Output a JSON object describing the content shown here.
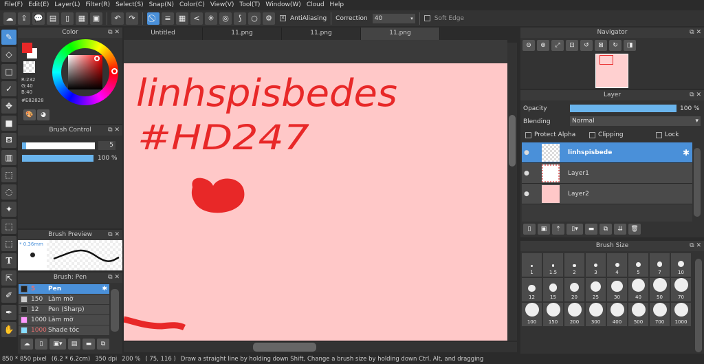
{
  "menu": [
    "File(F)",
    "Edit(E)",
    "Layer(L)",
    "Filter(R)",
    "Select(S)",
    "Snap(N)",
    "Color(C)",
    "View(V)",
    "Tool(T)",
    "Window(W)",
    "Cloud",
    "Help"
  ],
  "toolbar": {
    "antialiasing": "AntiAliasing",
    "correction_label": "Correction",
    "correction_value": "40",
    "soft_edge": "Soft Edge"
  },
  "tabs": [
    "Untitled",
    "11.png",
    "11.png",
    "11.png"
  ],
  "active_tab": 3,
  "color_panel": {
    "title": "Color",
    "r": "R:232",
    "g": "G:40",
    "b": "B:40",
    "hex": "#E82828",
    "primary": "#e82828"
  },
  "brush_control": {
    "title": "Brush Control",
    "size": "5",
    "opacity": "100 %",
    "opacity_value": 100
  },
  "brush_preview": {
    "title": "Brush Preview",
    "size": "* 0.36mm"
  },
  "brush_list": {
    "title": "Brush: Pen",
    "items": [
      {
        "size": "5",
        "name": "Pen",
        "color": "#222222"
      },
      {
        "size": "150",
        "name": "Làm mờ",
        "color": "#cccccc"
      },
      {
        "size": "12",
        "name": "Pen (Sharp)",
        "color": "#222222"
      },
      {
        "size": "1000",
        "name": "Làm mờ",
        "color": "#ff99ff"
      },
      {
        "size": "1000",
        "name": "Shade tóc",
        "color": "#88ddff"
      }
    ]
  },
  "canvas": {
    "text_line1": "linhspisbedes",
    "text_line2": "#HD247",
    "ink": "#e82828",
    "paper": "#ffc8c8"
  },
  "navigator": {
    "title": "Navigator"
  },
  "layer_panel": {
    "title": "Layer",
    "opacity_label": "Opacity",
    "opacity": "100 %",
    "opacity_value": 100,
    "blending_label": "Blending",
    "blending": "Normal",
    "protect_alpha": "Protect Alpha",
    "clipping": "Clipping",
    "lock": "Lock",
    "layers": [
      {
        "name": "linhspisbede",
        "selected": true
      },
      {
        "name": "Layer1"
      },
      {
        "name": "Layer2"
      }
    ]
  },
  "brush_size": {
    "title": "Brush Size",
    "sizes": [
      "1",
      "1.5",
      "2",
      "3",
      "4",
      "5",
      "7",
      "10",
      "12",
      "15",
      "20",
      "25",
      "30",
      "40",
      "50",
      "70",
      "100",
      "150",
      "200",
      "300",
      "400",
      "500",
      "700",
      "1000"
    ]
  },
  "status": {
    "pixel": "850 * 850 pixel",
    "cm": "(6.2 * 6.2cm)",
    "dpi": "350 dpi",
    "zoom": "200 %",
    "coords": "( 75, 116 )",
    "hint": "Draw a straight line by holding down Shift, Change a brush size by holding down Ctrl, Alt, and dragging"
  }
}
